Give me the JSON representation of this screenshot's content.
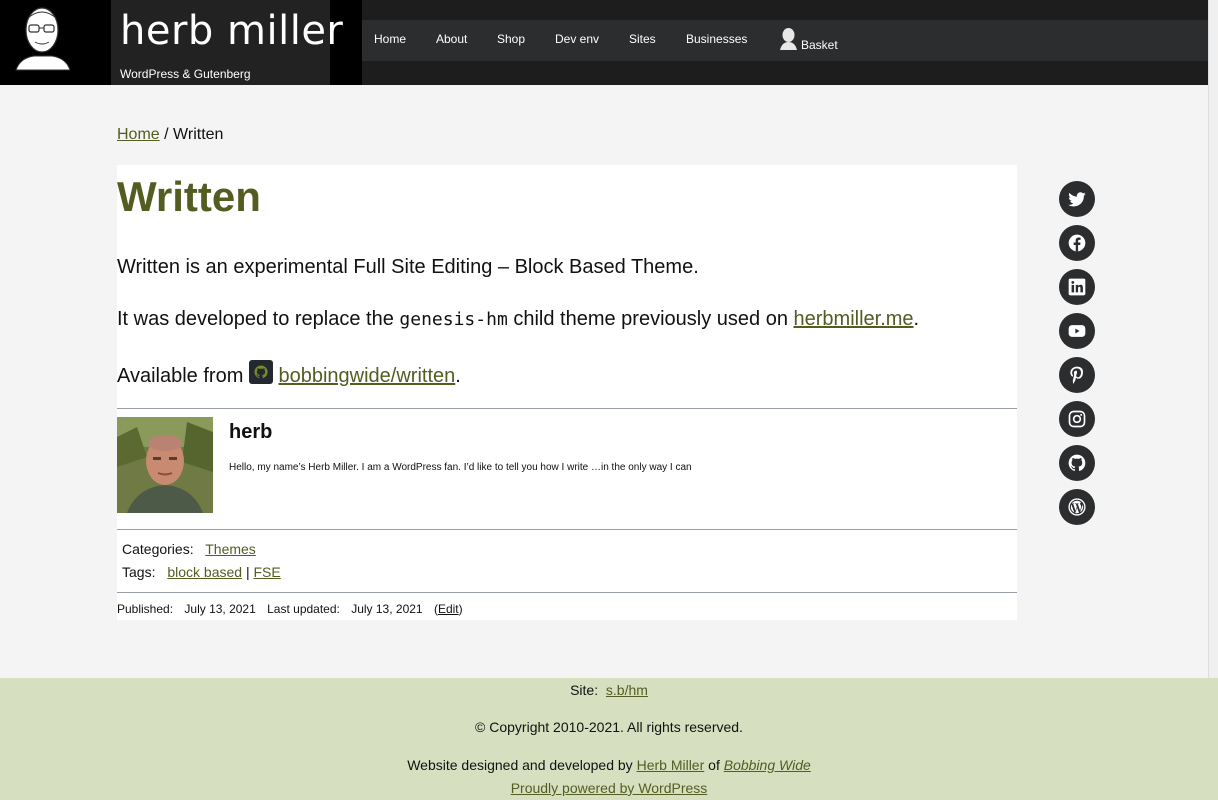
{
  "header": {
    "site_title": "herb miller",
    "tagline": "WordPress & Gutenberg",
    "nav": [
      "Home",
      "About",
      "Shop",
      "Dev env",
      "Sites",
      "Businesses"
    ],
    "basket_label": "Basket"
  },
  "breadcrumb": {
    "home": "Home",
    "separator": "/",
    "current": "Written"
  },
  "article": {
    "title": "Written",
    "p1": "Written is an experimental Full Site Editing – Block Based Theme.",
    "p2_before": "It was developed to replace the ",
    "p2_code": "genesis-hm",
    "p2_after": " child theme previously used on ",
    "p2_link": "herbmiller.me",
    "p2_end": ".",
    "p3_before": "Available from ",
    "p3_link": "bobbingwide/written",
    "p3_end": "."
  },
  "author": {
    "name": "herb",
    "bio": "Hello, my name’s Herb Miller. I am a WordPress fan. I’d like to tell you how I write …in the only way I can"
  },
  "meta": {
    "categories_label": "Categories:",
    "categories": [
      "Themes"
    ],
    "tags_label": "Tags:",
    "tags": [
      "block based",
      "FSE"
    ],
    "tags_sep": "|",
    "published_label": "Published:",
    "published_date": "July 13, 2021",
    "updated_label": "Last updated:",
    "updated_date": "July 13, 2021",
    "edit_open": "(",
    "edit_label": "Edit",
    "edit_close": ")"
  },
  "social": [
    "twitter-icon",
    "facebook-icon",
    "linkedin-icon",
    "youtube-icon",
    "pinterest-icon",
    "instagram-icon",
    "github-icon",
    "wordpress-icon"
  ],
  "footer": {
    "site_label": "Site:",
    "site_link": "s.b/hm",
    "copyright": "© Copyright 2010-2021. All rights reserved.",
    "designed_by": "Website designed and developed by ",
    "designer_link": "Herb Miller",
    "of": " of ",
    "company_link": "Bobbing Wide",
    "powered": "Proudly powered by WordPress"
  },
  "colors": {
    "accent": "#545c22",
    "header_bg": "#000000",
    "nav_bg": "#2b2d2f",
    "footer_bg": "#d6e0c0",
    "social_bg": "#2b2d2f"
  }
}
